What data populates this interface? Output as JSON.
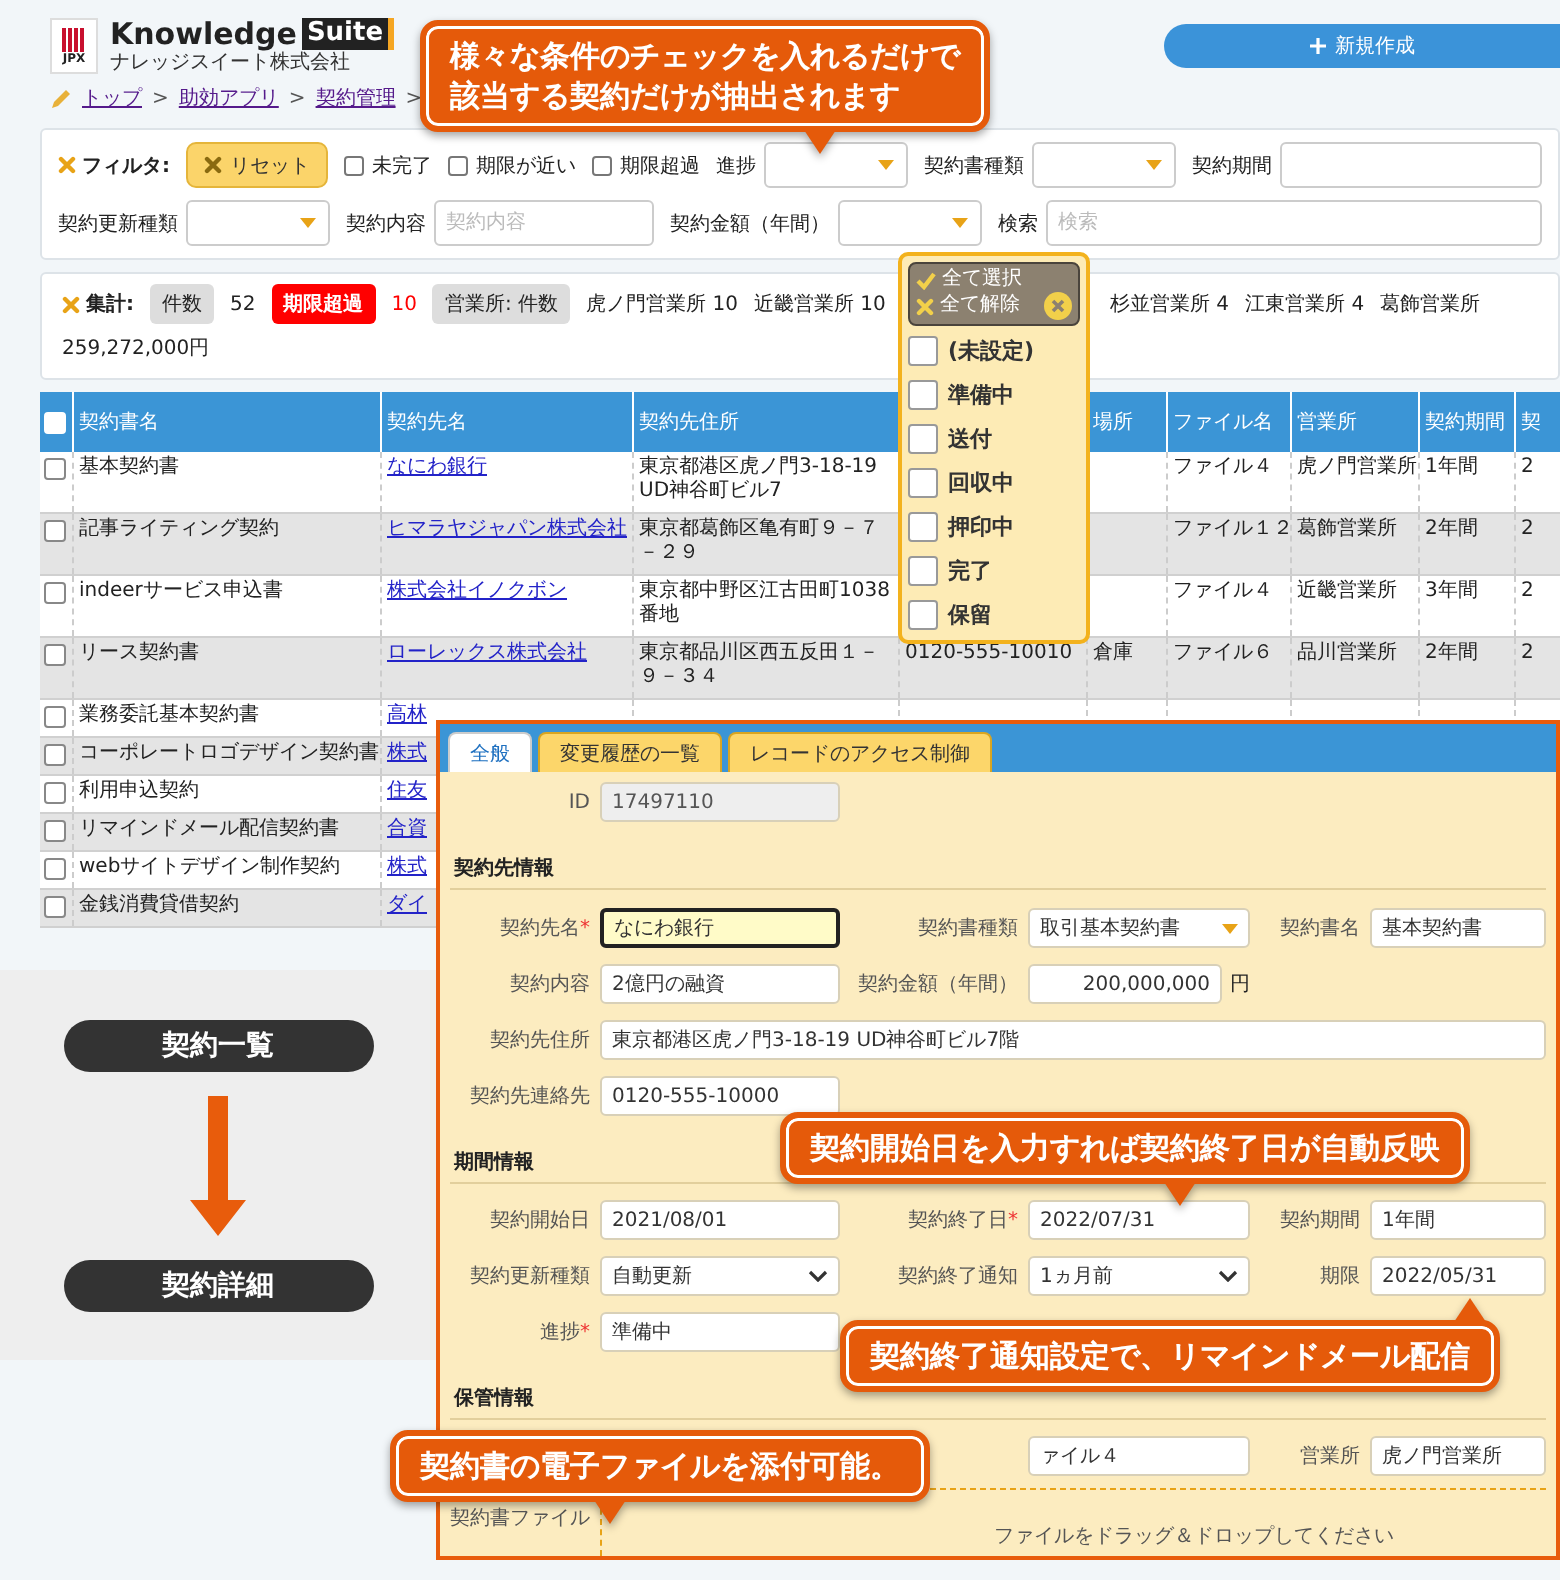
{
  "header": {
    "logo_mark": "JPX",
    "logo_name": "Knowledge",
    "logo_badge": "Suite",
    "logo_company": "ナレッジスイート株式会社",
    "new_button": "新規作成"
  },
  "breadcrumb": {
    "separator": ">",
    "items": [
      "トップ",
      "助効アプリ",
      "契約管理"
    ]
  },
  "filter": {
    "label": "フィルタ:",
    "reset": "リセット",
    "lines": [
      {
        "items": [
          {
            "kind": "check",
            "label": "未完了",
            "checked": false
          },
          {
            "kind": "check",
            "label": "期限が近い",
            "checked": false
          },
          {
            "kind": "check",
            "label": "期限超過",
            "checked": false
          },
          {
            "kind": "select",
            "label": "進捗"
          },
          {
            "kind": "select",
            "label": "契約書種類"
          },
          {
            "kind": "input",
            "label": "契約期間"
          }
        ]
      },
      {
        "items": [
          {
            "kind": "select",
            "label": "契約更新種類"
          },
          {
            "kind": "input",
            "label": "契約内容",
            "placeholder": "契約内容"
          },
          {
            "kind": "select",
            "label": "契約金額（年間）"
          },
          {
            "kind": "input",
            "label": "検索",
            "placeholder": "検索"
          }
        ]
      }
    ]
  },
  "summary": {
    "label": "集計:",
    "count_label": "件数",
    "count": "52",
    "overdue_label": "期限超過",
    "overdue": "10",
    "office_label": "営業所: 件数",
    "offices": [
      "虎ノ門営業所 10",
      "近畿営業所 10",
      "杉並営業所 4",
      "江東営業所 4",
      "葛飾営業所"
    ],
    "total": "259,272,000円"
  },
  "status_menu": {
    "select_all": "全て選択",
    "clear_all": "全て解除",
    "options": [
      {
        "label": "(未設定)",
        "checked": false
      },
      {
        "label": "準備中",
        "checked": false
      },
      {
        "label": "送付",
        "checked": false
      },
      {
        "label": "回収中",
        "checked": false
      },
      {
        "label": "押印中",
        "checked": false
      },
      {
        "label": "完了",
        "checked": false
      },
      {
        "label": "保留",
        "checked": false
      }
    ]
  },
  "table": {
    "header_checked": false,
    "columns": [
      "契約書名",
      "契約先名",
      "契約先住所",
      "",
      "場所",
      "ファイル名",
      "営業所",
      "契約期間",
      "契"
    ],
    "rows": [
      {
        "checked": false,
        "cells": [
          "基本契約書",
          "なにわ銀行",
          "東京都港区虎ノ門3-18-19 UD神谷町ビル7",
          "",
          "",
          "ファイル４",
          "虎ノ門営業所",
          "1年間",
          "2"
        ]
      },
      {
        "checked": false,
        "cells": [
          "記事ライティング契約",
          "ヒマラヤジャパン株式会社",
          "東京都葛飾区亀有町９－７－２９",
          "",
          "",
          "ファイル１２",
          "葛飾営業所",
          "2年間",
          "2"
        ]
      },
      {
        "checked": false,
        "cells": [
          "indeerサービス申込書",
          "株式会社イノクボン",
          "東京都中野区江古田町1038番地",
          "",
          "",
          "ファイル４",
          "近畿営業所",
          "3年間",
          "2"
        ]
      },
      {
        "checked": false,
        "cells": [
          "リース契約書",
          "ローレックス株式会社",
          "東京都品川区西五反田１－９－３４",
          "0120-555-10010",
          "倉庫",
          "ファイル６",
          "品川営業所",
          "2年間",
          "2"
        ]
      },
      {
        "checked": false,
        "cells": [
          "業務委託基本契約書",
          "高林"
        ]
      },
      {
        "checked": false,
        "cells": [
          "コーポレートロゴデザイン契約書",
          "株式"
        ]
      },
      {
        "checked": false,
        "cells": [
          "利用申込契約",
          "住友"
        ]
      },
      {
        "checked": false,
        "cells": [
          "リマインドメール配信契約書",
          "合資"
        ]
      },
      {
        "checked": false,
        "cells": [
          "webサイトデザイン制作契約",
          "株式"
        ]
      },
      {
        "checked": false,
        "cells": [
          "金銭消費貸借契約",
          "ダイ"
        ]
      }
    ]
  },
  "flow": {
    "steps": [
      "契約一覧",
      "契約詳細"
    ]
  },
  "detail": {
    "required_mark": "*",
    "tabs": [
      {
        "label": "全般",
        "selected": true
      },
      {
        "label": "変更履歴の一覧",
        "selected": false
      },
      {
        "label": "レコードのアクセス制御",
        "selected": false
      }
    ],
    "id_field": {
      "label": "ID",
      "value": "17497110"
    },
    "sections": [
      {
        "title": "契約先情報",
        "rows": [
          [
            {
              "kind": "text",
              "label": "契約先名",
              "required": true,
              "focused": true,
              "value": "なにわ銀行"
            },
            {
              "kind": "dropdown",
              "label": "契約書種類",
              "required": false,
              "focused": false,
              "value": "取引基本契約書"
            },
            {
              "kind": "text",
              "label": "契約書名",
              "required": false,
              "focused": false,
              "value": "基本契約書"
            }
          ],
          [
            {
              "kind": "text",
              "label": "契約内容",
              "required": false,
              "focused": false,
              "value": "2億円の融資"
            },
            {
              "kind": "money",
              "label": "契約金額（年間）",
              "required": false,
              "focused": false,
              "value": "200,000,000",
              "unit": "円"
            }
          ],
          [
            {
              "kind": "wide",
              "label": "契約先住所",
              "required": false,
              "focused": false,
              "value": "東京都港区虎ノ門3-18-19 UD神谷町ビル7階"
            }
          ],
          [
            {
              "kind": "text",
              "label": "契約先連絡先",
              "required": false,
              "focused": false,
              "value": "0120-555-10000"
            }
          ]
        ]
      },
      {
        "title": "期間情報",
        "rows": [
          [
            {
              "kind": "text",
              "label": "契約開始日",
              "required": false,
              "focused": false,
              "value": "2021/08/01"
            },
            {
              "kind": "text",
              "label": "契約終了日",
              "required": true,
              "focused": false,
              "value": "2022/07/31"
            },
            {
              "kind": "text",
              "label": "契約期間",
              "required": false,
              "focused": false,
              "value": "1年間"
            }
          ],
          [
            {
              "kind": "select",
              "label": "契約更新種類",
              "required": false,
              "focused": false,
              "value": "自動更新"
            },
            {
              "kind": "select",
              "label": "契約終了通知",
              "required": false,
              "focused": false,
              "value": "1ヵ月前"
            },
            {
              "kind": "text",
              "label": "期限",
              "required": false,
              "focused": false,
              "value": "2022/05/31"
            }
          ],
          [
            {
              "kind": "text",
              "label": "進捗",
              "required": true,
              "focused": false,
              "value": "準備中"
            }
          ]
        ]
      },
      {
        "title": "保管情報",
        "rows": [
          [
            {
              "kind": "text",
              "focused": false,
              "value": "ァイル４"
            },
            {
              "kind": "text",
              "label": "営業所",
              "required": false,
              "focused": false,
              "value": "虎ノ門営業所"
            }
          ]
        ]
      }
    ],
    "file_field": {
      "label": "契約書ファイル",
      "hint": "ファイルをドラッグ＆ドロップしてください"
    }
  },
  "callouts": [
    {
      "lines": [
        "様々な条件のチェックを入れるだけで",
        "該当する契約だけが抽出されます"
      ]
    },
    {
      "lines": [
        "契約開始日を入力すれば契約終了日が自動反映"
      ]
    },
    {
      "lines": [
        "契約終了通知設定で、リマインドメール配信"
      ]
    },
    {
      "lines": [
        "契約書の電子ファイルを添付可能。"
      ]
    }
  ]
}
